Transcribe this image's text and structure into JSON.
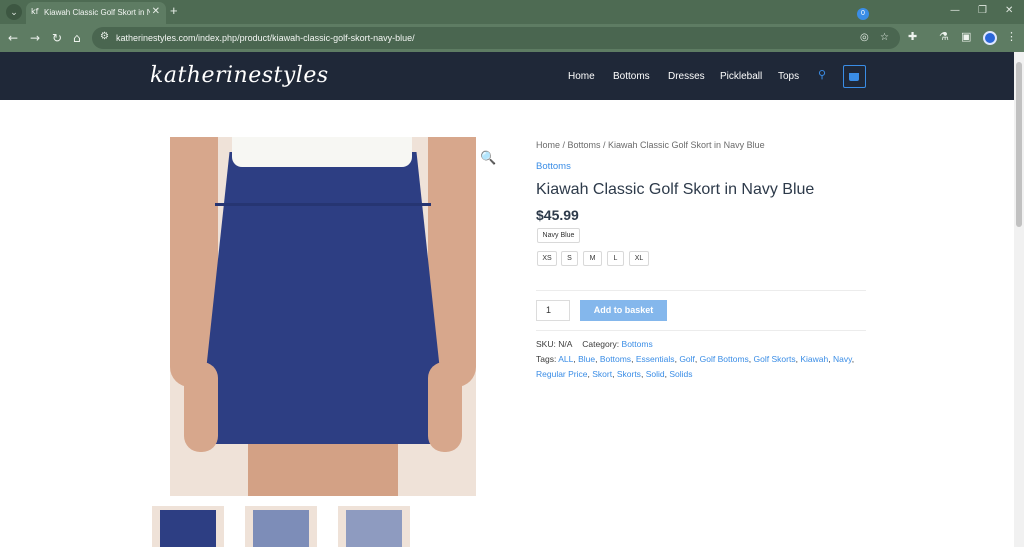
{
  "browser": {
    "tab_title": "Kiawah Classic Golf Skort in Na",
    "url": "katherinestyles.com/index.php/product/kiawah-classic-golf-skort-navy-blue/"
  },
  "site": {
    "logo": "katherinestyles",
    "nav": [
      "Home",
      "Bottoms",
      "Dresses",
      "Pickleball",
      "Tops"
    ],
    "cart_count": "0"
  },
  "product": {
    "breadcrumb": "Home / Bottoms / Kiawah Classic Golf Skort in Navy Blue",
    "category": "Bottoms",
    "title": "Kiawah Classic Golf Skort in Navy Blue",
    "price": "$45.99",
    "color": "Navy Blue",
    "sizes": [
      "XS",
      "S",
      "M",
      "L",
      "XL"
    ],
    "quantity": "1",
    "add_to_basket": "Add to basket",
    "sku_label": "SKU:",
    "sku_value": "N/A",
    "category_label": "Category:",
    "category_value": "Bottoms",
    "tags_label": "Tags:",
    "tags_line1": [
      "ALL",
      "Blue",
      "Bottoms",
      "Essentials",
      "Golf",
      "Golf Bottoms",
      "Golf Skorts",
      "Kiawah",
      "Navy"
    ],
    "tags_line2": [
      "Regular Price",
      "Skort",
      "Skorts",
      "Solid",
      "Solids"
    ]
  },
  "colors": {
    "header_bg": "#1f2838",
    "accent": "#3a8de6",
    "button": "#84b7ec",
    "skort": "#2d3e83"
  }
}
